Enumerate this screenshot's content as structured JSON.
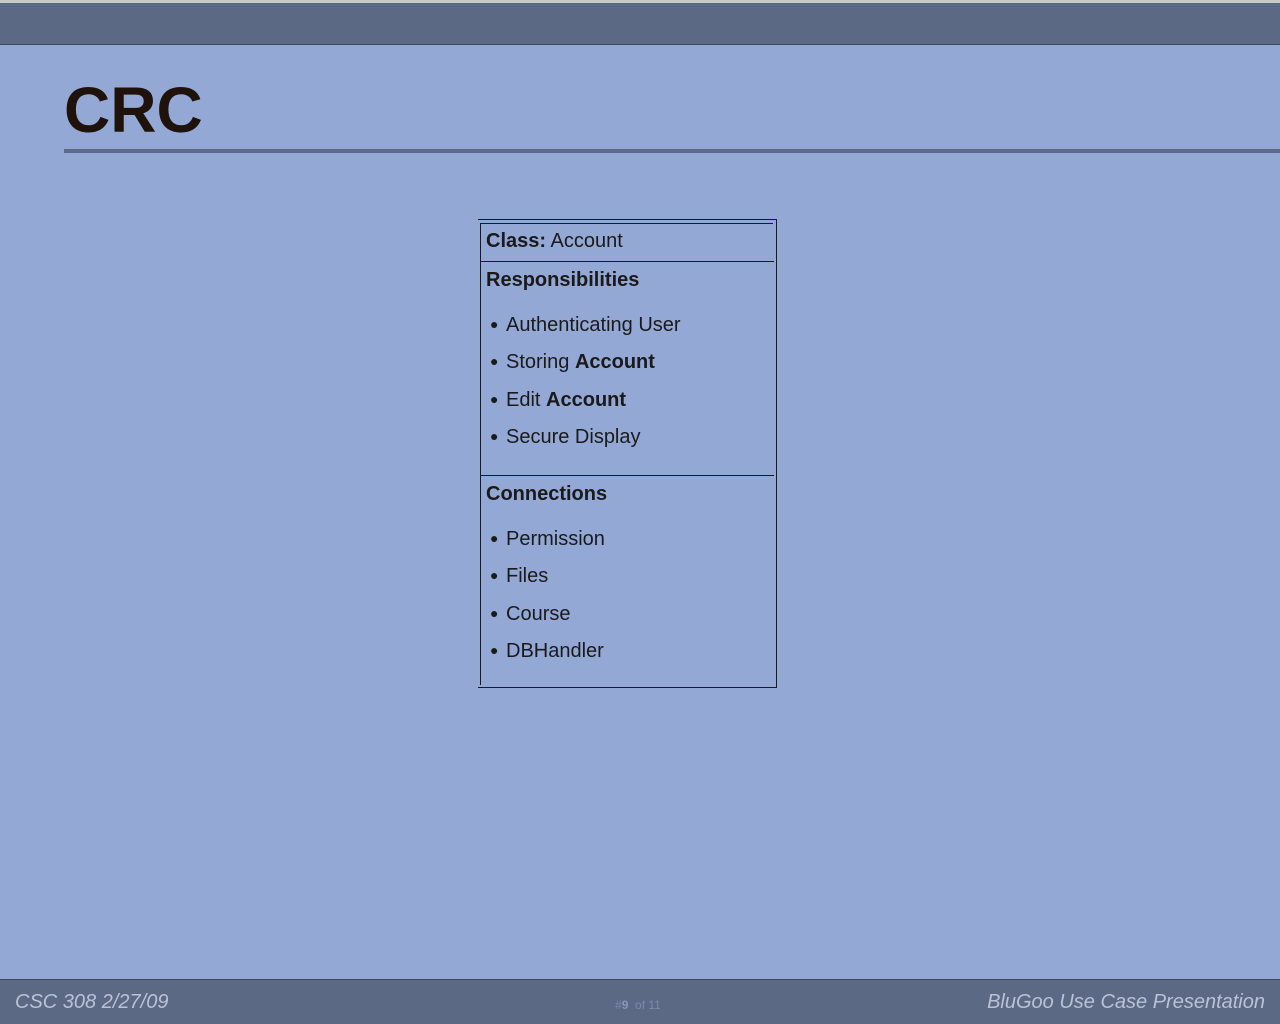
{
  "slide": {
    "title": "CRC"
  },
  "card": {
    "class_label": "Class:",
    "class_name": "Account",
    "responsibilities_header": "Responsibilities",
    "responsibilities": [
      {
        "text": "Authenticating User",
        "bold": ""
      },
      {
        "text": "Storing",
        "bold": "Account"
      },
      {
        "text": "Edit",
        "bold": "Account"
      },
      {
        "text": "Secure Display",
        "bold": ""
      }
    ],
    "connections_header": "Connections",
    "connections": [
      "Permission",
      "Files",
      "Course",
      "DBHandler"
    ],
    "bullet": "●"
  },
  "footer": {
    "left": "CSC 308 2/27/09",
    "right": "BluGoo Use Case Presentation",
    "page_prefix": "#",
    "page_current": "9",
    "page_of": "of 11"
  },
  "colors": {
    "background": "#94a8d6",
    "bar": "#5c6984",
    "title_text": "#1e120a"
  }
}
